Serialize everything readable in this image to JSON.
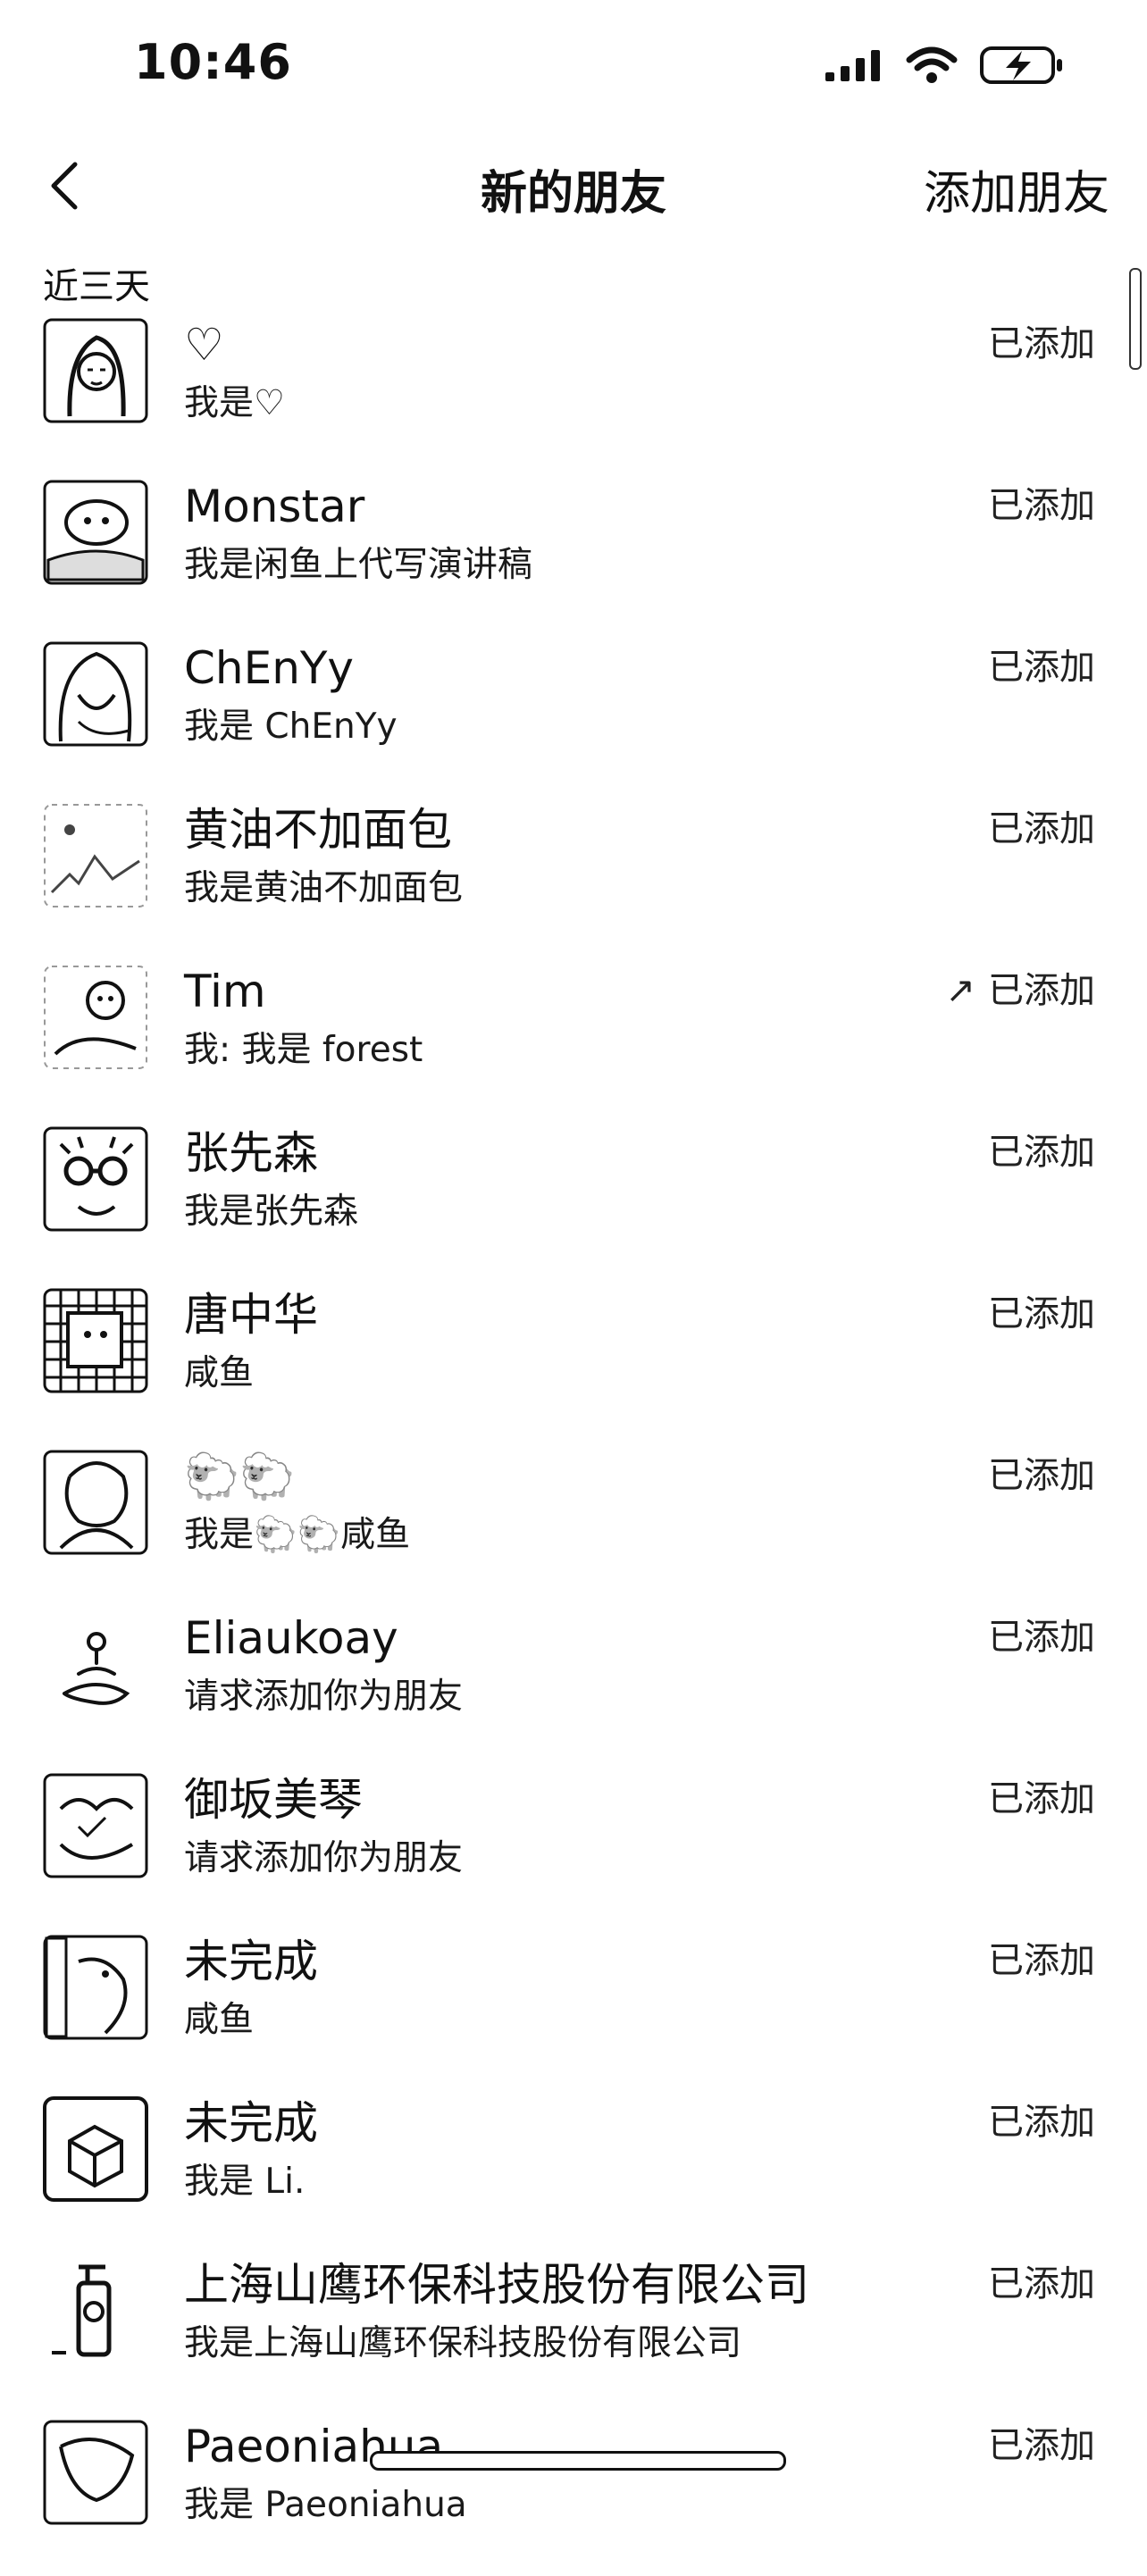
{
  "status_bar": {
    "time": "10:46"
  },
  "nav": {
    "title": "新的朋友",
    "add_friend_label": "添加朋友"
  },
  "section": {
    "label": "近三天"
  },
  "friends": [
    {
      "name": "♡",
      "message": "我是♡",
      "status": "已添加",
      "arrow": ""
    },
    {
      "name": "Monstar",
      "message": "我是闲鱼上代写演讲稿",
      "status": "已添加",
      "arrow": ""
    },
    {
      "name": "ChEnYy",
      "message": "我是 ChEnYy",
      "status": "已添加",
      "arrow": ""
    },
    {
      "name": "黄油不加面包",
      "message": "我是黄油不加面包",
      "status": "已添加",
      "arrow": ""
    },
    {
      "name": "Tim",
      "message": "我: 我是 forest",
      "status": "已添加",
      "arrow": "↗"
    },
    {
      "name": "张先森",
      "message": "我是张先森",
      "status": "已添加",
      "arrow": ""
    },
    {
      "name": "唐中华",
      "message": "咸鱼",
      "status": "已添加",
      "arrow": ""
    },
    {
      "name": "🐑🐑",
      "message": "我是🐑🐑咸鱼",
      "status": "已添加",
      "arrow": ""
    },
    {
      "name": "Eliaukoay",
      "message": "请求添加你为朋友",
      "status": "已添加",
      "arrow": ""
    },
    {
      "name": "御坂美琴",
      "message": "请求添加你为朋友",
      "status": "已添加",
      "arrow": ""
    },
    {
      "name": "未完成",
      "message": "咸鱼",
      "status": "已添加",
      "arrow": ""
    },
    {
      "name": "未完成",
      "message": "我是 Li.",
      "status": "已添加",
      "arrow": ""
    },
    {
      "name": "上海山鹰环保科技股份有限公司",
      "message": "我是上海山鹰环保科技股份有限公司",
      "status": "已添加",
      "arrow": ""
    },
    {
      "name": "Paeoniahua",
      "message": "我是 Paeoniahua",
      "status": "已添加",
      "arrow": ""
    }
  ],
  "icons": {
    "back": "chevron-left-icon",
    "signal": "cellular-signal-icon",
    "wifi": "wifi-icon",
    "battery": "battery-charging-icon"
  },
  "colors": {
    "text": "#111111",
    "background": "#ffffff"
  }
}
